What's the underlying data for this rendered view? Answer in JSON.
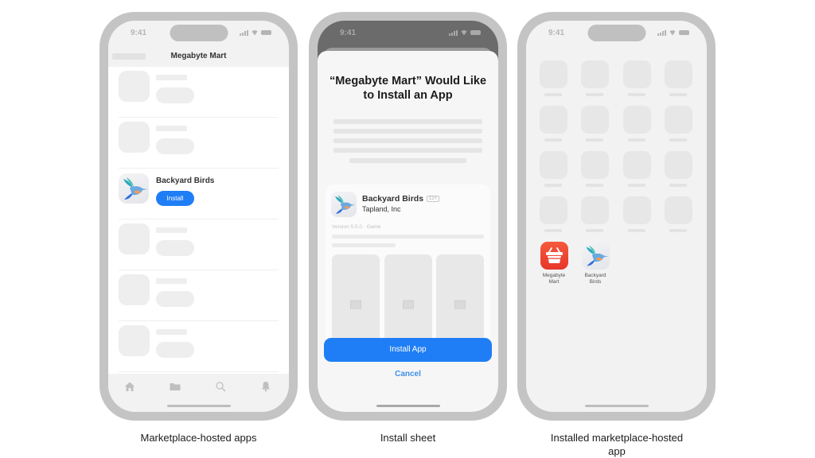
{
  "status_bar": {
    "time": "9:41"
  },
  "phones": [
    {
      "caption": "Marketplace-hosted apps",
      "nav_title": "Megabyte Mart",
      "featured_app": {
        "name": "Backyard Birds",
        "button_label": "Install"
      },
      "tabs": [
        {
          "icon": "home-icon"
        },
        {
          "icon": "folder-icon"
        },
        {
          "icon": "search-icon"
        },
        {
          "icon": "bell-icon"
        }
      ]
    },
    {
      "caption": "Install sheet",
      "sheet_title": "“Megabyte Mart” Would Like to Install an App",
      "app": {
        "name": "Backyard Birds",
        "age_rating": "12+",
        "developer": "Tapland, Inc",
        "version_info": "Version 5.5.0 · Game"
      },
      "primary_button": "Install App",
      "cancel_button": "Cancel"
    },
    {
      "caption": "Installed marketplace-hosted app",
      "installed_apps": [
        {
          "name": "Megabyte Mart",
          "color": "#f0442c"
        },
        {
          "name": "Backyard Birds"
        }
      ]
    }
  ],
  "colors": {
    "accent_blue": "#1f7ef5",
    "frame_gray": "#c4c4c4",
    "megabyte_red": "#f0442c"
  }
}
